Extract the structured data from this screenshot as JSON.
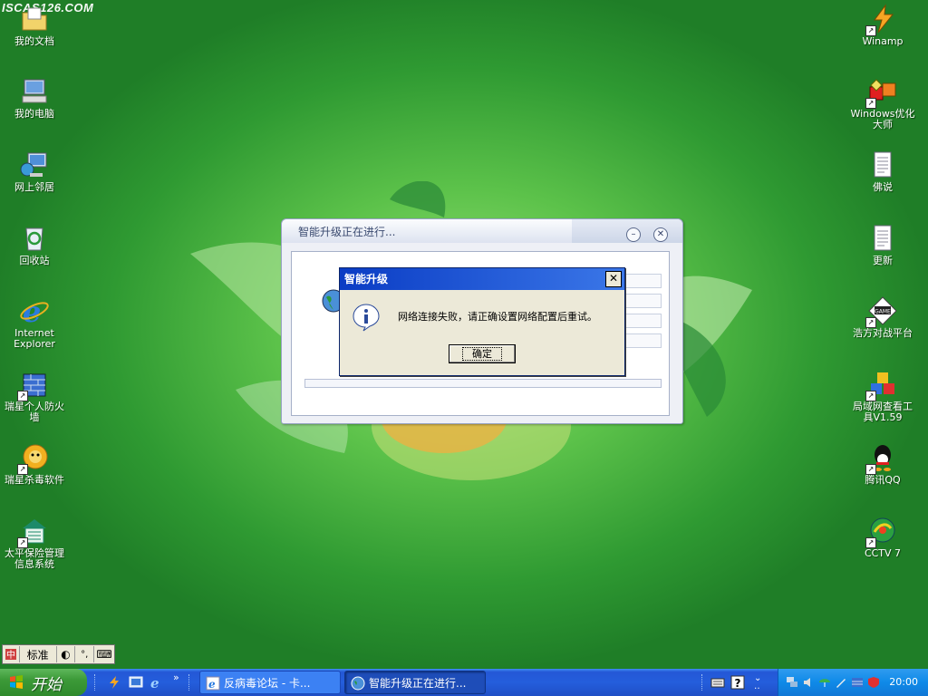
{
  "watermark": "ISCAS126.COM",
  "desktop": {
    "left_icons": [
      {
        "name": "documents-icon",
        "label": "我的文档"
      },
      {
        "name": "computer-icon",
        "label": "我的电脑"
      },
      {
        "name": "network-icon",
        "label": "网上邻居"
      },
      {
        "name": "recycle-bin-icon",
        "label": "回收站"
      },
      {
        "name": "internet-explorer-icon",
        "label": "Internet Explorer"
      },
      {
        "name": "firewall-icon",
        "label": "瑞星个人防火墙"
      },
      {
        "name": "antivirus-icon",
        "label": "瑞星杀毒软件"
      },
      {
        "name": "insurance-app-icon",
        "label": "太平保险管理信息系统"
      }
    ],
    "right_icons": [
      {
        "name": "winamp-icon",
        "label": "Winamp"
      },
      {
        "name": "optimizer-icon",
        "label": "Windows优化大师"
      },
      {
        "name": "notepad-doc-icon",
        "label": "佛说"
      },
      {
        "name": "notepad-doc-icon",
        "label": "更新"
      },
      {
        "name": "game-platform-icon",
        "label": "浩方对战平台"
      },
      {
        "name": "lan-tool-icon",
        "label": "局域网查看工具V1.59"
      },
      {
        "name": "qq-icon",
        "label": "腾讯QQ"
      },
      {
        "name": "cctv-icon",
        "label": "CCTV 7"
      }
    ]
  },
  "upgrade_window": {
    "title": "智能升级正在进行..."
  },
  "message_box": {
    "title": "智能升级",
    "close_glyph": "✕",
    "text": "网络连接失败，请正确设置网络配置后重试。",
    "ok_label": "确定"
  },
  "ime_bar": {
    "mode": "标准"
  },
  "taskbar": {
    "start_label": "开始",
    "buttons": [
      {
        "label": "反病毒论坛 - 卡..."
      },
      {
        "label": "智能升级正在进行..."
      }
    ],
    "clock": "20:00"
  },
  "colors": {
    "taskbar_blue": "#245edc",
    "start_green": "#3c9a38",
    "titlebar_blue": "#0a3cc4",
    "desktop_green": "#2f9a32"
  }
}
